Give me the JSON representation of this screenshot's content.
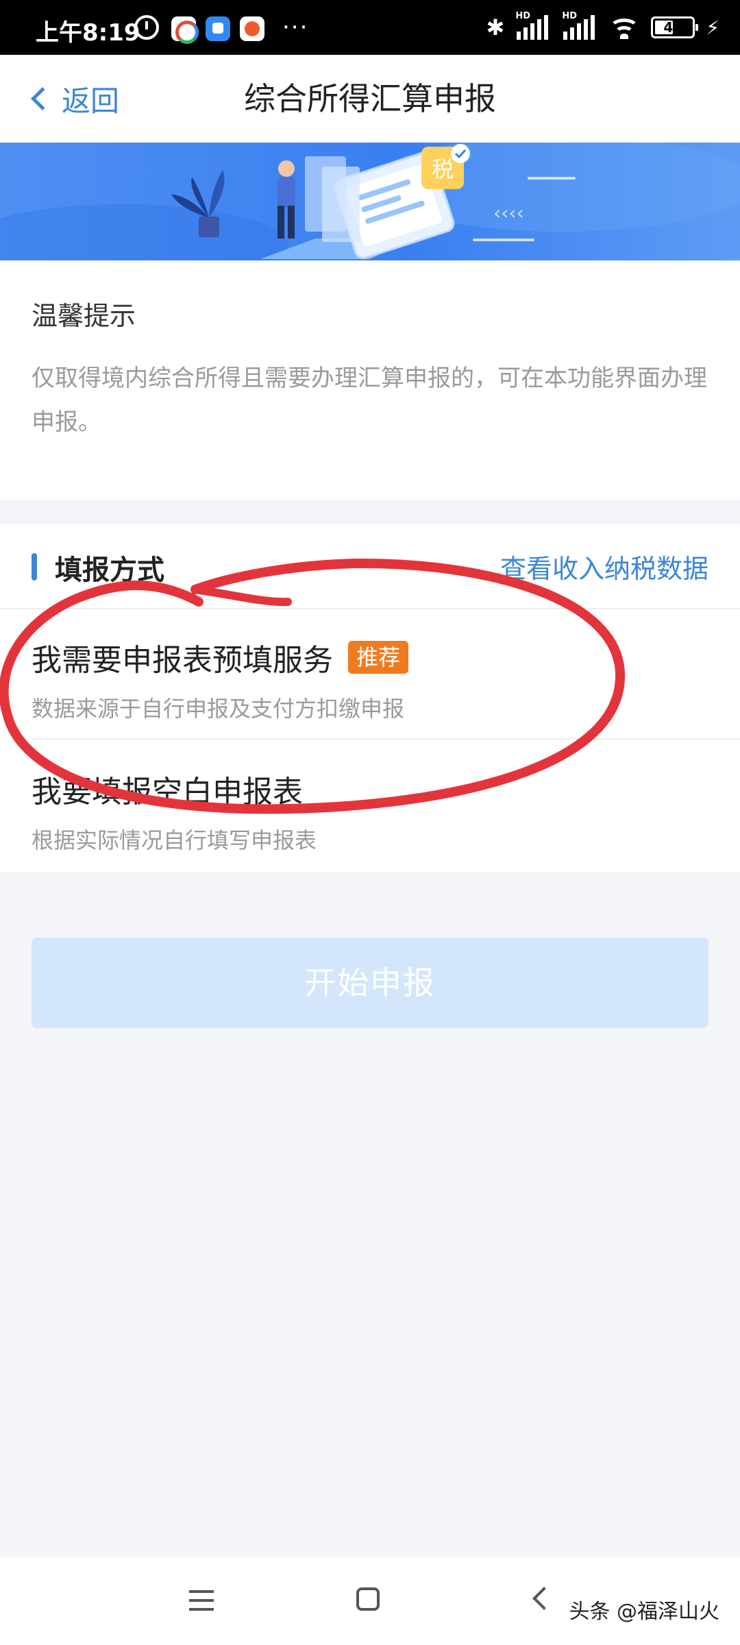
{
  "status_bar": {
    "time": "上午8:19",
    "signal_label_1": "HD",
    "signal_label_2": "HD",
    "battery": "44"
  },
  "nav": {
    "back_label": "返回",
    "title": "综合所得汇算申报"
  },
  "banner": {
    "tax_badge": "税"
  },
  "notice": {
    "title": "温馨提示",
    "text": "仅取得境内综合所得且需要办理汇算申报的，可在本功能界面办理申报。"
  },
  "method": {
    "title": "填报方式",
    "link": "查看收入纳税数据",
    "options": [
      {
        "title": "我需要申报表预填服务",
        "badge": "推荐",
        "subtitle": "数据来源于自行申报及支付方扣缴申报"
      },
      {
        "title": "我要填报空白申报表",
        "subtitle": "根据实际情况自行填写申报表"
      }
    ]
  },
  "start_button": "开始申报",
  "watermark": "头条 @福泽山火",
  "colors": {
    "brand_blue": "#3c86d6",
    "badge_orange": "#f07a1e",
    "annotation_red": "#e3343c",
    "disabled_button": "#d3e6fb"
  }
}
